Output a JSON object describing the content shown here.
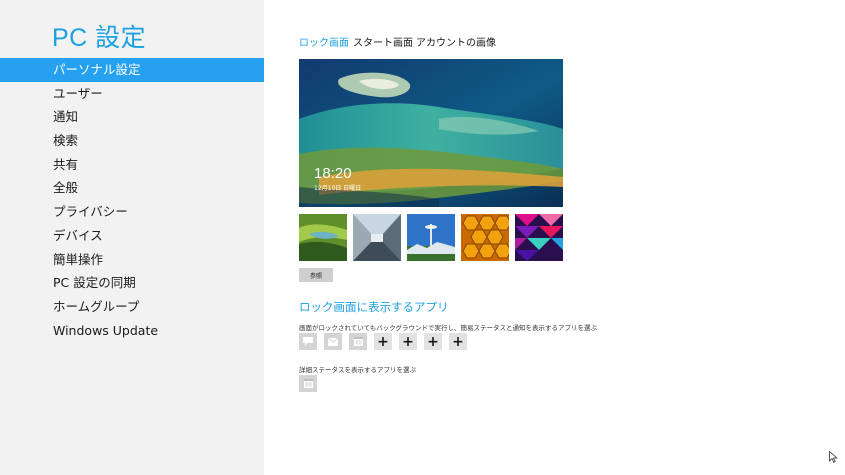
{
  "sidebar": {
    "title": "PC 設定",
    "items": [
      {
        "label": "パーソナル設定",
        "selected": true
      },
      {
        "label": "ユーザー",
        "selected": false
      },
      {
        "label": "通知",
        "selected": false
      },
      {
        "label": "検索",
        "selected": false
      },
      {
        "label": "共有",
        "selected": false
      },
      {
        "label": "全般",
        "selected": false
      },
      {
        "label": "プライバシー",
        "selected": false
      },
      {
        "label": "デバイス",
        "selected": false
      },
      {
        "label": "簡単操作",
        "selected": false
      },
      {
        "label": "PC 設定の同期",
        "selected": false
      },
      {
        "label": "ホームグループ",
        "selected": false
      },
      {
        "label": "Windows Update",
        "selected": false
      }
    ]
  },
  "tabs": [
    {
      "label": "ロック画面",
      "active": true
    },
    {
      "label": "スタート画面",
      "active": false
    },
    {
      "label": "アカウントの画像",
      "active": false
    }
  ],
  "preview": {
    "time": "18:20",
    "date": "12月10日 日曜日"
  },
  "thumbnails": [
    "green-valley",
    "glass-corridor",
    "space-needle",
    "honeycomb",
    "color-grid"
  ],
  "browse_button": "参照",
  "lock_apps": {
    "title": "ロック画面に表示するアプリ",
    "quick_status_desc": "画面がロックされていてもバックグラウンドで実行し、簡易ステータスと通知を表示するアプリを選ぶ",
    "quick_status_slots": [
      {
        "icon": "messaging-icon",
        "type": "app"
      },
      {
        "icon": "mail-icon",
        "type": "app"
      },
      {
        "icon": "calendar-icon",
        "type": "app"
      },
      {
        "icon": "plus-icon",
        "type": "add"
      },
      {
        "icon": "plus-icon",
        "type": "add"
      },
      {
        "icon": "plus-icon",
        "type": "add"
      },
      {
        "icon": "plus-icon",
        "type": "add"
      }
    ],
    "detailed_status_desc": "詳細ステータスを表示するアプリを選ぶ",
    "detailed_status_slot": {
      "icon": "calendar-icon",
      "type": "app"
    },
    "plus_symbol": "+"
  },
  "colors": {
    "accent": "#1ba1e2",
    "selected_bg": "#26a0f0",
    "sidebar_bg": "#f2f2f2"
  }
}
